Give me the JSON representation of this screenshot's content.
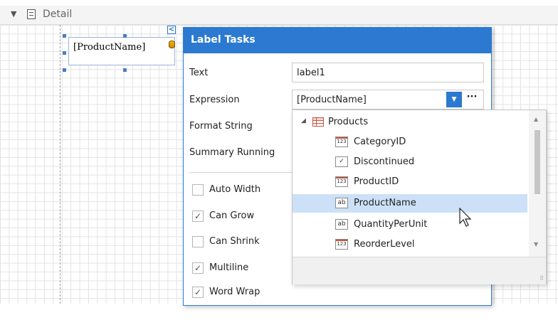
{
  "band": {
    "title": "Detail"
  },
  "label_control": {
    "text": "[ProductName]"
  },
  "panel": {
    "title": "Label Tasks",
    "properties": [
      {
        "label": "Text",
        "value": "label1"
      },
      {
        "label": "Expression",
        "value": "[ProductName]"
      },
      {
        "label": "Format String",
        "value": ""
      },
      {
        "label": "Summary Running",
        "value": ""
      }
    ],
    "checkboxes": [
      {
        "label": "Auto Width",
        "checked": false
      },
      {
        "label": "Can Grow",
        "checked": true
      },
      {
        "label": "Can Shrink",
        "checked": false
      },
      {
        "label": "Multiline",
        "checked": true
      },
      {
        "label": "Word Wrap",
        "checked": true
      }
    ]
  },
  "dropdown": {
    "root": "Products",
    "fields": [
      {
        "name": "CategoryID",
        "type": "123"
      },
      {
        "name": "Discontinued",
        "type": "check"
      },
      {
        "name": "ProductID",
        "type": "123"
      },
      {
        "name": "ProductName",
        "type": "ab",
        "selected": true
      },
      {
        "name": "QuantityPerUnit",
        "type": "ab"
      },
      {
        "name": "ReorderLevel",
        "type": "123"
      }
    ]
  },
  "colors": {
    "accent": "#2b79d0",
    "selection": "#cce1f7"
  }
}
